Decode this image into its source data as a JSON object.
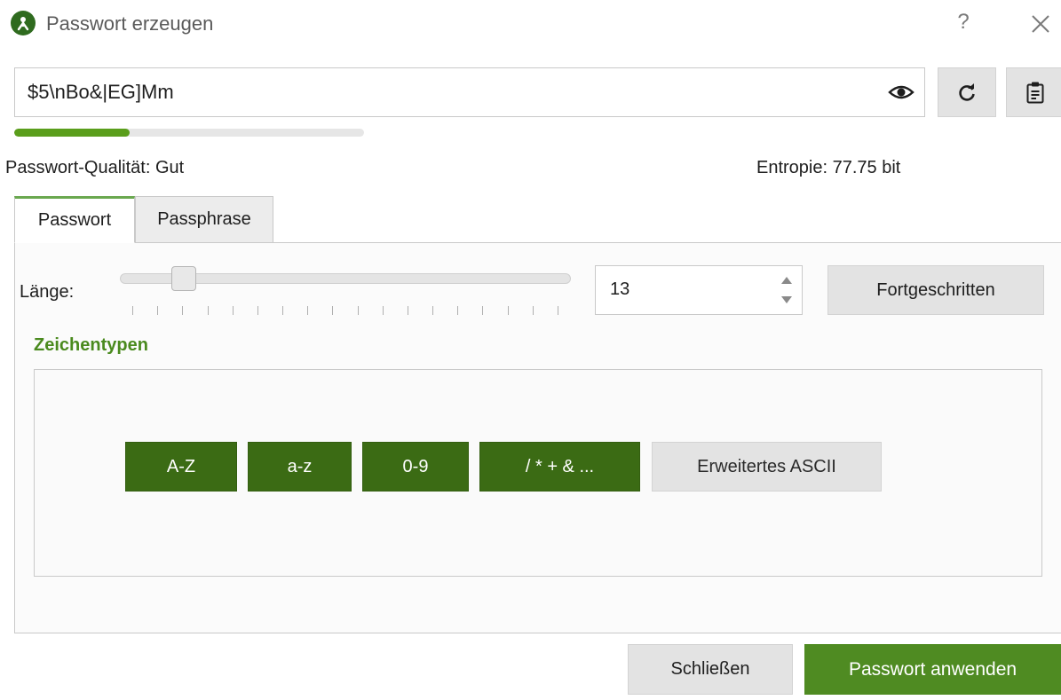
{
  "window": {
    "title": "Passwort erzeugen",
    "help_label": "?",
    "logo_icon": "keepassxc-logo-icon",
    "close_icon": "close-icon"
  },
  "password": {
    "value": "$5\\nBo&|EG]Mm",
    "toggle_icon": "eye-icon",
    "regenerate_icon": "refresh-icon",
    "copy_icon": "clipboard-icon"
  },
  "quality": {
    "level_fraction": 0.33,
    "color": "#5a9e1b",
    "label": "Passwort-Qualität: Gut",
    "entropy": "Entropie: 77.75 bit"
  },
  "tabs": [
    {
      "label": "Passwort",
      "active": true
    },
    {
      "label": "Passphrase",
      "active": false
    }
  ],
  "length": {
    "label": "Länge:",
    "slider_fraction": 0.12,
    "value": "13",
    "tick_count": 18
  },
  "advanced_label": "Fortgeschritten",
  "char_types": {
    "title": "Zeichentypen",
    "buttons": [
      {
        "label": "A-Z",
        "active": true
      },
      {
        "label": "a-z",
        "active": true
      },
      {
        "label": "0-9",
        "active": true
      },
      {
        "label": "/ * + & ...",
        "active": true
      },
      {
        "label": "Erweitertes ASCII",
        "active": false
      }
    ]
  },
  "footer": {
    "close_label": "Schließen",
    "apply_label": "Passwort anwenden"
  },
  "colors": {
    "accent": "#4f8b22",
    "active_toggle": "#3b6b14"
  }
}
